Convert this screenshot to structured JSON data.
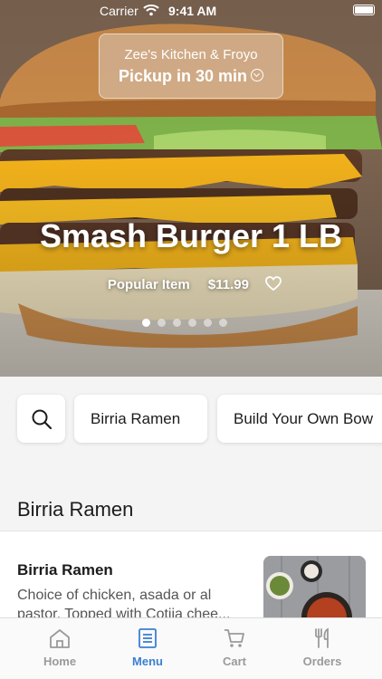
{
  "status_bar": {
    "carrier": "Carrier",
    "time": "9:41 AM"
  },
  "store": {
    "name": "Zee's Kitchen & Froyo",
    "pickup": "Pickup in 30 min"
  },
  "hero": {
    "title": "Smash Burger 1 LB",
    "badge": "Popular Item",
    "price": "$11.99",
    "carousel": {
      "count": 6,
      "active_index": 0
    }
  },
  "categories": {
    "search_icon": "search-icon",
    "chips": [
      "Birria Ramen",
      "Build Your Own Bow"
    ]
  },
  "section": {
    "title": "Birria Ramen"
  },
  "menu_items": [
    {
      "name": "Birria Ramen",
      "description": "Choice of chicken, asada or al pastor. Topped with Cotija chee..."
    }
  ],
  "tabbar": {
    "tabs": [
      {
        "label": "Home",
        "icon": "home-icon"
      },
      {
        "label": "Menu",
        "icon": "menu-icon"
      },
      {
        "label": "Cart",
        "icon": "cart-icon"
      },
      {
        "label": "Orders",
        "icon": "orders-icon"
      }
    ],
    "active": "Menu",
    "active_color": "#3a7fd2",
    "inactive_color": "#9a9a9a"
  }
}
